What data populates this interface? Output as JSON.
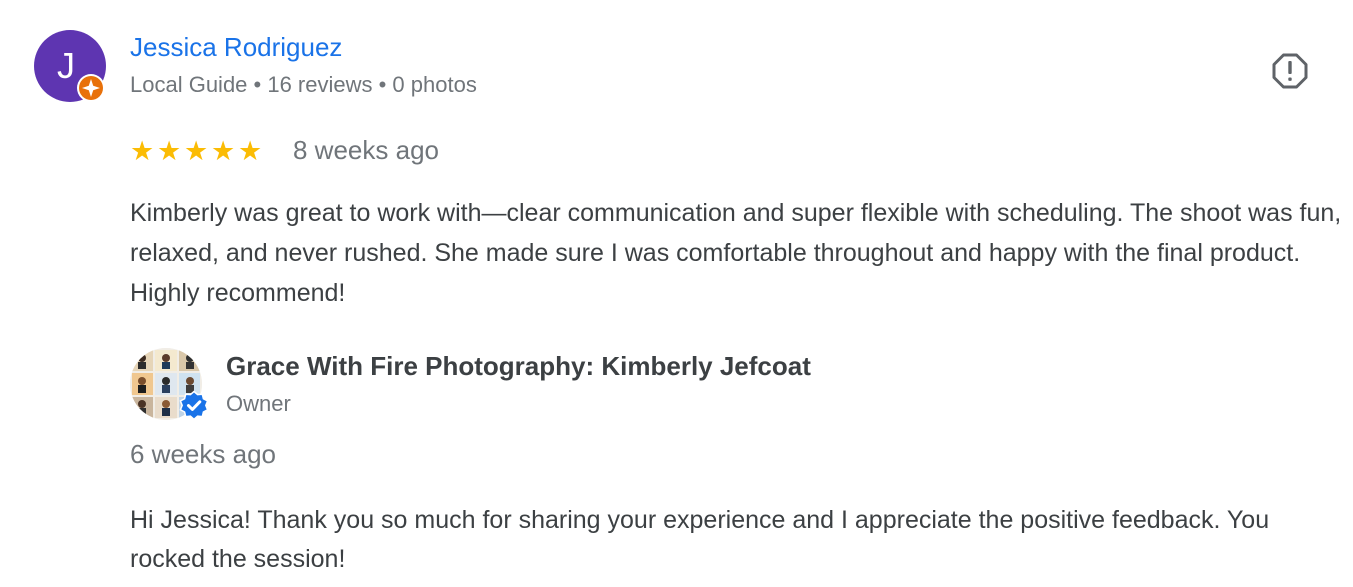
{
  "review": {
    "reviewer": {
      "initial": "J",
      "name": "Jessica Rodriguez",
      "meta": "Local Guide • 16 reviews • 0 photos",
      "avatar_color": "#5e35b1",
      "badge_icon": "local-guide-star-icon",
      "badge_color": "#e8710a"
    },
    "report_icon": "report-flag-icon",
    "rating": 5,
    "rating_max": 5,
    "star_color": "#fbbc04",
    "date": "8 weeks ago",
    "text": "Kimberly was great to work with—clear communication and super flexible with scheduling. The shoot was fun, relaxed, and never rushed. She made sure I was comfortable throughout and happy with the final product. Highly recommend!"
  },
  "owner_response": {
    "name": "Grace With Fire Photography: Kimberly Jefcoat",
    "role": "Owner",
    "avatar_icon": "photo-collage-avatar",
    "verified_icon": "verified-badge-icon",
    "verified_color": "#1a73e8",
    "date": "6 weeks ago",
    "text": "Hi Jessica! Thank you so much for sharing your experience and I appreciate the positive feedback. You rocked the session!"
  },
  "colors": {
    "link": "#1a73e8",
    "text": "#3c4043",
    "secondary": "#70757a"
  }
}
